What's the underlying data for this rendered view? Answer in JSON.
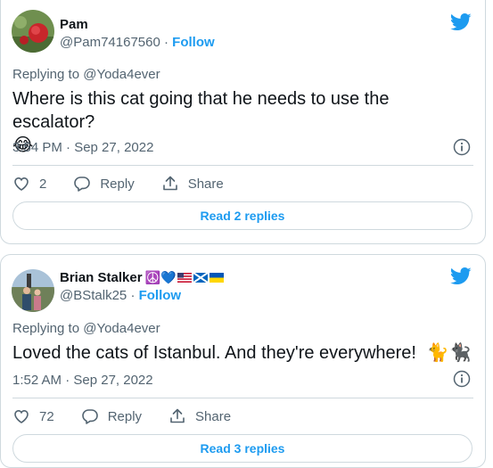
{
  "tweets": [
    {
      "name": "Pam",
      "handle": "@Pam74167560",
      "separator": "·",
      "follow_label": "Follow",
      "replying_prefix": "Replying to ",
      "replying_to": "@Yoda4ever",
      "text": "Where is this cat going that he needs to use the escalator?",
      "text_emoji": "😂",
      "time": "3:54 PM · Sep 27, 2022",
      "likes": "2",
      "reply_label": "Reply",
      "share_label": "Share",
      "read_replies_label": "Read 2 replies"
    },
    {
      "name": "Brian Stalker",
      "name_emojis": [
        "☮️",
        "💙"
      ],
      "handle": "@BStalk25",
      "separator": "·",
      "follow_label": "Follow",
      "replying_prefix": "Replying to ",
      "replying_to": "@Yoda4ever",
      "text": "Loved the cats of Istanbul. And they're everywhere!",
      "text_emoji": "🐈🐈‍⬛",
      "time": "1:52 AM · Sep 27, 2022",
      "likes": "72",
      "reply_label": "Reply",
      "share_label": "Share",
      "read_replies_label": "Read 3 replies"
    }
  ],
  "icons": {
    "brand": "twitter-bird-icon",
    "info": "info-icon",
    "like": "heart-icon",
    "reply": "speech-bubble-icon",
    "share": "share-upload-icon"
  },
  "colors": {
    "accent": "#1d9bf0",
    "text": "#0f1419",
    "secondary": "#536471",
    "border": "#cfd9de"
  }
}
